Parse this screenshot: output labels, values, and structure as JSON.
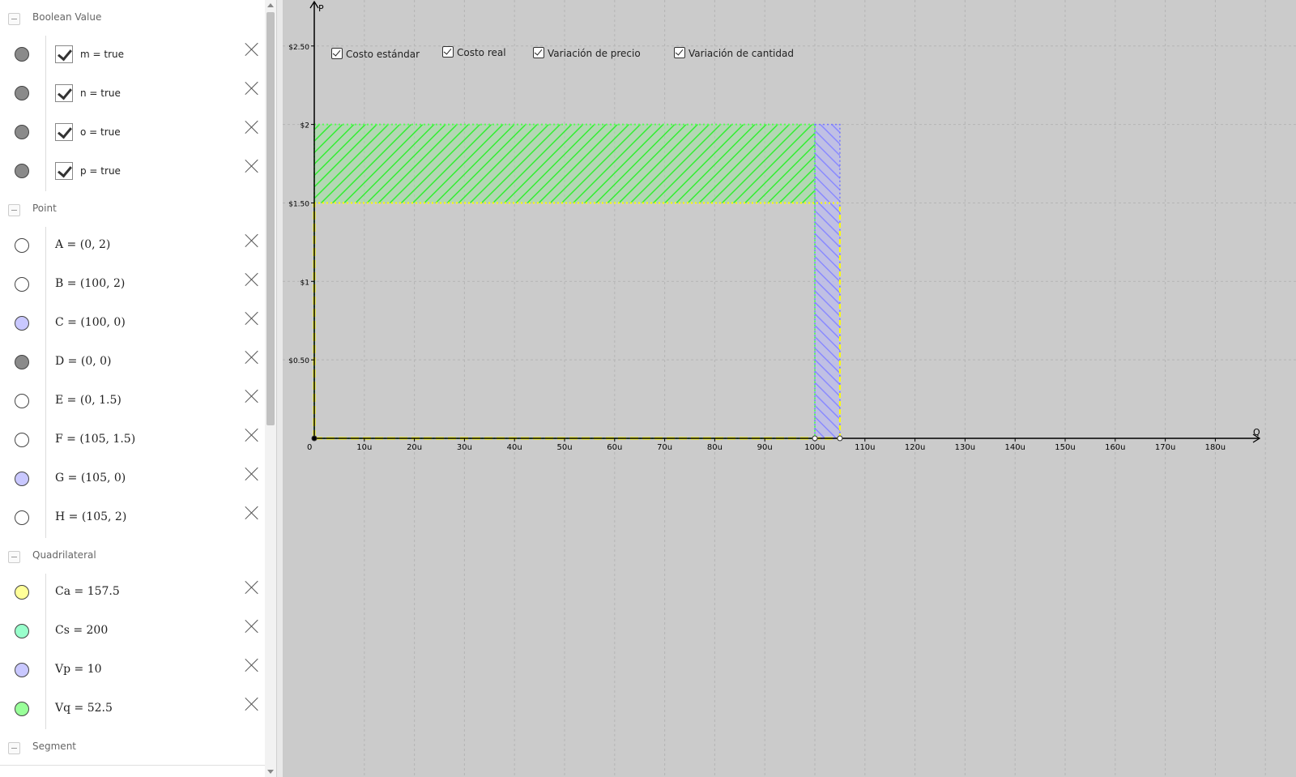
{
  "algebra": {
    "categories": {
      "boolean": "Boolean Value",
      "point": "Point",
      "quadrilateral": "Quadrilateral",
      "segment": "Segment"
    },
    "booleans": [
      {
        "def": "m = true",
        "checked": true,
        "color": "#8a8a8a"
      },
      {
        "def": "n = true",
        "checked": true,
        "color": "#8a8a8a"
      },
      {
        "def": "o = true",
        "checked": true,
        "color": "#8a8a8a"
      },
      {
        "def": "p = true",
        "checked": true,
        "color": "#8a8a8a"
      }
    ],
    "points": [
      {
        "def": "A = (0, 2)",
        "color": "#ffffff"
      },
      {
        "def": "B = (100, 2)",
        "color": "#ffffff"
      },
      {
        "def": "C = (100, 0)",
        "color": "#c9c8ff"
      },
      {
        "def": "D = (0, 0)",
        "color": "#8a8a8a"
      },
      {
        "def": "E = (0, 1.5)",
        "color": "#ffffff"
      },
      {
        "def": "F = (105, 1.5)",
        "color": "#ffffff"
      },
      {
        "def": "G = (105, 0)",
        "color": "#c9c8ff"
      },
      {
        "def": "H = (105, 2)",
        "color": "#ffffff"
      }
    ],
    "quadrilaterals": [
      {
        "def": "Ca = 157.5",
        "color": "#ffff99"
      },
      {
        "def": "Cs = 200",
        "color": "#99ffcc"
      },
      {
        "def": "Vp = 10",
        "color": "#c9c8ff"
      },
      {
        "def": "Vq = 52.5",
        "color": "#99ff99"
      }
    ]
  },
  "graphics": {
    "x_axis_label": "Q",
    "y_axis_label": "P",
    "origin_label": "0",
    "checkboxes": [
      {
        "label": "Costo estándar",
        "checked": true
      },
      {
        "label": "Costo real",
        "checked": true
      },
      {
        "label": "Variación de precio",
        "checked": true
      },
      {
        "label": "Variación de cantidad",
        "checked": true
      }
    ],
    "x_ticks": [
      {
        "value": 10,
        "label": "10u"
      },
      {
        "value": 20,
        "label": "20u"
      },
      {
        "value": 30,
        "label": "30u"
      },
      {
        "value": 40,
        "label": "40u"
      },
      {
        "value": 50,
        "label": "50u"
      },
      {
        "value": 60,
        "label": "60u"
      },
      {
        "value": 70,
        "label": "70u"
      },
      {
        "value": 80,
        "label": "80u"
      },
      {
        "value": 90,
        "label": "90u"
      },
      {
        "value": 100,
        "label": "100u"
      },
      {
        "value": 110,
        "label": "110u"
      },
      {
        "value": 120,
        "label": "120u"
      },
      {
        "value": 130,
        "label": "130u"
      },
      {
        "value": 140,
        "label": "140u"
      },
      {
        "value": 150,
        "label": "150u"
      },
      {
        "value": 160,
        "label": "160u"
      },
      {
        "value": 170,
        "label": "170u"
      },
      {
        "value": 180,
        "label": "180u"
      }
    ],
    "y_ticks": [
      {
        "value": 0.5,
        "label": "$0.50"
      },
      {
        "value": 1,
        "label": "$1"
      },
      {
        "value": 1.5,
        "label": "$1.50"
      },
      {
        "value": 2,
        "label": "$2"
      },
      {
        "value": 2.5,
        "label": "$2.50"
      }
    ],
    "colors": {
      "background": "#cbcbcb",
      "grid": "#b5b5b5",
      "standard": "#55ff55",
      "real": "#ffff00",
      "price_variance": "#9999ff",
      "quantity_variance": "#66ff66"
    },
    "shapes": {
      "standard_cost": {
        "q": 100,
        "p": 2
      },
      "real_cost": {
        "q": 105,
        "p": 1.5
      },
      "price_variance": {
        "q_from": 0,
        "q_to": 100,
        "p_from": 1.5,
        "p_to": 2
      },
      "quantity_variance": {
        "q_from": 100,
        "q_to": 105,
        "p_from": 0,
        "p_to": 2
      }
    },
    "points": [
      {
        "name": "A",
        "q": 0,
        "p": 2
      },
      {
        "name": "B",
        "q": 100,
        "p": 2
      },
      {
        "name": "C",
        "q": 100,
        "p": 0
      },
      {
        "name": "D",
        "q": 0,
        "p": 0
      },
      {
        "name": "E",
        "q": 0,
        "p": 1.5
      },
      {
        "name": "F",
        "q": 105,
        "p": 1.5
      },
      {
        "name": "G",
        "q": 105,
        "p": 0
      },
      {
        "name": "H",
        "q": 105,
        "p": 2
      }
    ]
  }
}
